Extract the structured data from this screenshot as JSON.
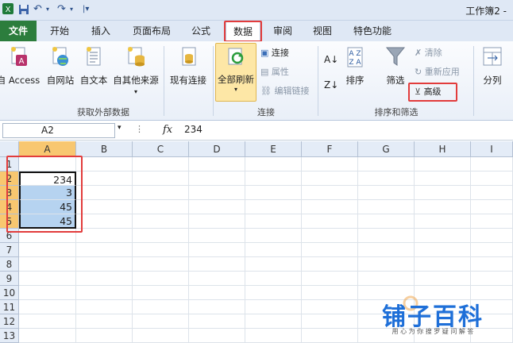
{
  "window": {
    "title": "工作簿2 -"
  },
  "quick_access": {
    "save_icon": "save-icon",
    "undo_icon": "undo-icon",
    "redo_icon": "redo-icon"
  },
  "tabs": [
    {
      "label": "文件",
      "id": "file"
    },
    {
      "label": "开始",
      "id": "home"
    },
    {
      "label": "插入",
      "id": "insert"
    },
    {
      "label": "页面布局",
      "id": "layout"
    },
    {
      "label": "公式",
      "id": "formulas"
    },
    {
      "label": "数据",
      "id": "data",
      "active": true
    },
    {
      "label": "审阅",
      "id": "review"
    },
    {
      "label": "视图",
      "id": "view"
    },
    {
      "label": "特色功能",
      "id": "features"
    }
  ],
  "ribbon": {
    "external": {
      "access": "自 Access",
      "web": "自网站",
      "text": "自文本",
      "other": "自其他来源",
      "existing": "现有连接",
      "group": "获取外部数据"
    },
    "connections": {
      "refresh_all": "全部刷新",
      "connections": "连接",
      "properties": "属性",
      "edit_links": "编辑链接",
      "group": "连接"
    },
    "sort_filter": {
      "sort": "排序",
      "filter": "筛选",
      "clear": "清除",
      "reapply": "重新应用",
      "advanced": "高级",
      "group": "排序和筛选"
    },
    "tools": {
      "split": "分列"
    }
  },
  "formula_bar": {
    "name_box": "A2",
    "fx": "fx",
    "value": "234"
  },
  "sheet": {
    "columns": [
      "A",
      "B",
      "C",
      "D",
      "E",
      "F",
      "G",
      "H",
      "I"
    ],
    "rows": [
      "1",
      "2",
      "3",
      "4",
      "5",
      "6",
      "7",
      "8",
      "9",
      "10",
      "11",
      "12",
      "13"
    ],
    "cells": {
      "A2": "234",
      "A3": "3",
      "A4": "45",
      "A5": "45"
    }
  },
  "watermark": {
    "title": "铺子百科",
    "subtitle": "用 心 为 你 搜 罗 疑 问 解 答"
  }
}
